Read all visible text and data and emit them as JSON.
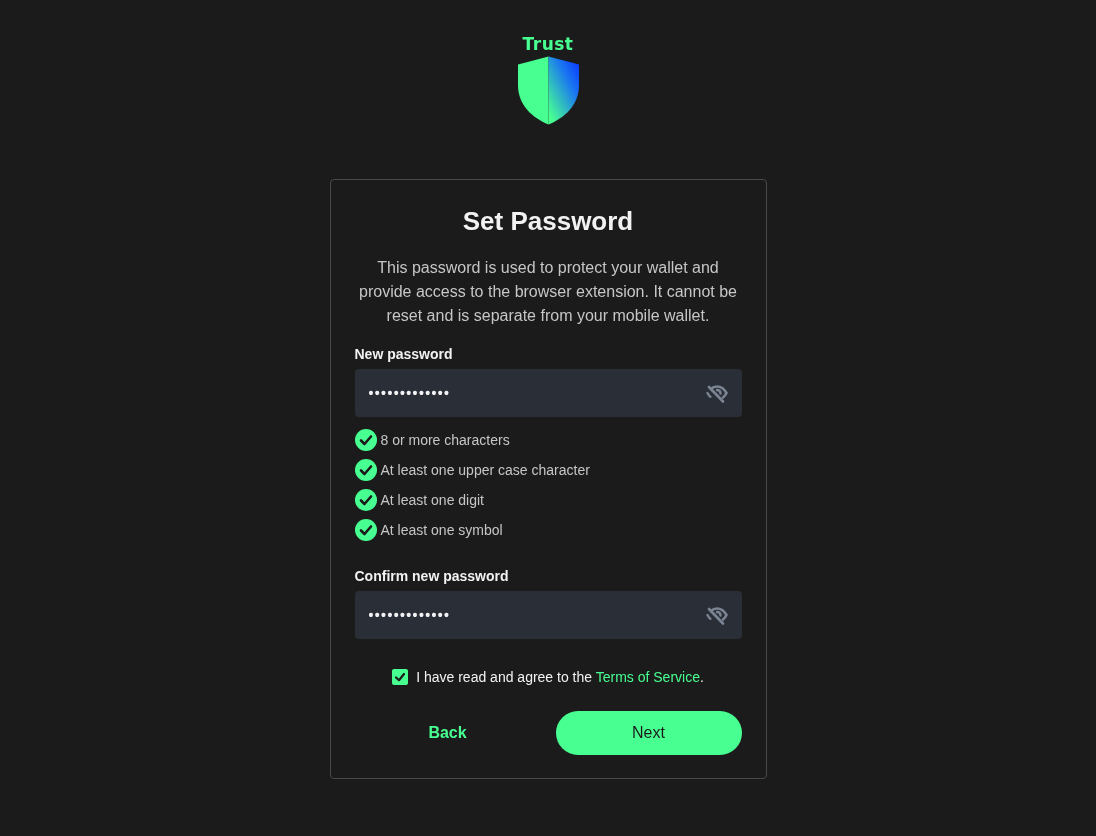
{
  "logo": {
    "wordmark": "Trust"
  },
  "card": {
    "title": "Set Password",
    "description": "This password is used to protect your wallet and provide access to the browser extension. It cannot be reset and is separate from your mobile wallet."
  },
  "new_password": {
    "label": "New password",
    "value": "•••••••••••••",
    "revealed": false,
    "requirements": [
      {
        "text": "8 or more characters",
        "met": true
      },
      {
        "text": "At least one upper case character",
        "met": true
      },
      {
        "text": "At least one digit",
        "met": true
      },
      {
        "text": "At least one symbol",
        "met": true
      }
    ]
  },
  "confirm_password": {
    "label": "Confirm new password",
    "value": "•••••••••••••",
    "revealed": false
  },
  "terms": {
    "checked": true,
    "text": "I have read and agree to the ",
    "link": "Terms of Service",
    "suffix": "."
  },
  "buttons": [
    {
      "label": "Back",
      "kind": "text"
    },
    {
      "label": "Next",
      "kind": "primary"
    }
  ]
}
